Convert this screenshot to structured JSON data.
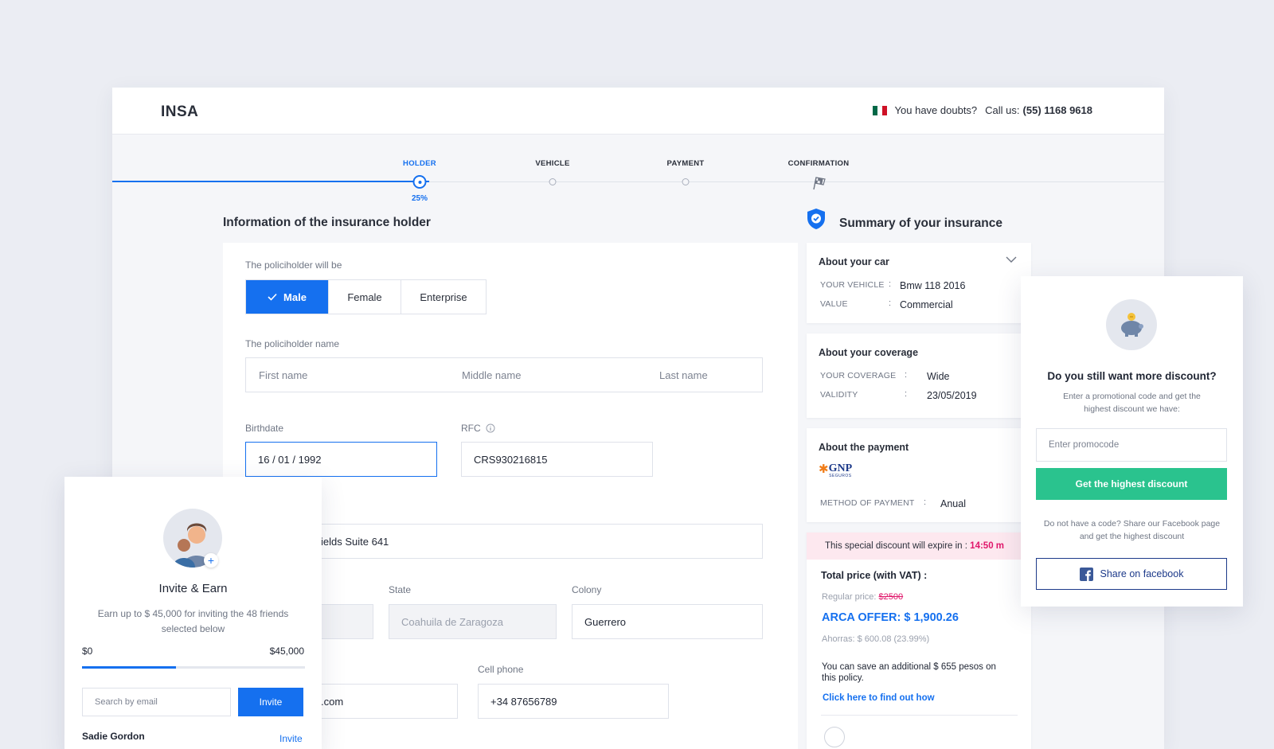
{
  "header": {
    "logo": "INSA",
    "doubts": "You have doubts?",
    "call_label": "Call us:",
    "phone": "(55) 1168 9618",
    "flag_colors": [
      "#006847",
      "#ffffff",
      "#ce1126"
    ]
  },
  "steps": {
    "items": [
      {
        "label": "HOLDER",
        "state": "current"
      },
      {
        "label": "VEHICLE",
        "state": "pending"
      },
      {
        "label": "PAYMENT",
        "state": "pending"
      },
      {
        "label": "CONFIRMATION",
        "state": "final"
      }
    ],
    "progress": "25%"
  },
  "form": {
    "title": "Information of the insurance holder",
    "policyholder_will_be_label": "The policiholder will be",
    "gender_options": [
      "Male",
      "Female",
      "Enterprise"
    ],
    "gender_selected": "Male",
    "name_label": "The policiholder name",
    "first_name_placeholder": "First name",
    "middle_name_placeholder": "Middle name",
    "last_name_placeholder": "Last name",
    "birthdate_label": "Birthdate",
    "birthdate_value": "16 / 01 / 1992",
    "rfc_label": "RFC",
    "rfc_value": "CRS930216815",
    "address_value": "ields Suite 641",
    "state_label": "State",
    "state_value": "Coahuila de Zaragoza",
    "colony_label": "Colony",
    "colony_value": "Guerrero",
    "email_value": ".com",
    "cell_label": "Cell phone",
    "cell_value": "+34 87656789"
  },
  "summary": {
    "title": "Summary of your insurance",
    "car": {
      "title": "About your car",
      "vehicle_key": "YOUR VEHICLE",
      "vehicle_value": "Bmw 118 2016",
      "value_key": "VALUE",
      "value_value": "Commercial"
    },
    "coverage": {
      "title": "About your coverage",
      "coverage_key": "YOUR COVERAGE",
      "coverage_value": "Wide",
      "validity_key": "VALIDITY",
      "validity_value": "23/05/2019"
    },
    "payment": {
      "title": "About the payment",
      "insurer_logo": "GNP",
      "insurer_sub": "SEGUROS",
      "method_key": "METHOD OF PAYMENT",
      "method_value": "Anual"
    },
    "discount_banner": "This special discount will expire in :",
    "discount_time": "14:50 m",
    "total_label": "Total price (with VAT)  :",
    "regular_label": "Regular price:",
    "regular_value": "$2500",
    "offer": "ARCA OFFER: $ 1,900.26",
    "savings": "Ahorras: $ 600.08 (23.99%)",
    "extra_save": "You can save an additional $ 655 pesos on this policy.",
    "find_out_link": "Click here to find out how",
    "colon": ":"
  },
  "promo_popup": {
    "title": "Do you still want more discount?",
    "subtitle": "Enter a promotional code and get the highest discount we have:",
    "input_placeholder": "Enter promocode",
    "button": "Get the highest discount",
    "share_text": "Do not have a code? Share our Facebook page and get the highest discount",
    "facebook_button": "Share on facebook",
    "button_color": "#2ac38e"
  },
  "invite_popup": {
    "title": "Invite & Earn",
    "subtitle": "Earn up to $ 45,000 for inviting the 48 friends selected below",
    "min": "$0",
    "max": "$45,000",
    "progress_fraction": 0.42,
    "search_placeholder": "Search by email",
    "invite_button": "Invite",
    "contact_name": "Sadie Gordon",
    "contact_action": "Invite"
  }
}
